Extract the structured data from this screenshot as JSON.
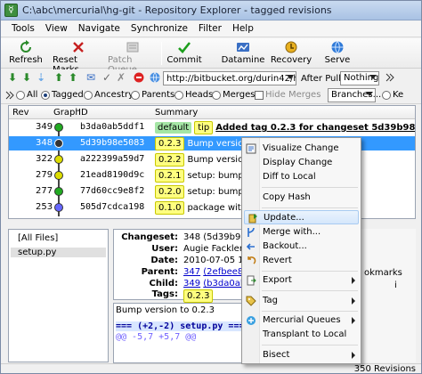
{
  "window": {
    "title": "C:\\abc\\mercurial\\hg-git - Repository Explorer - tagged revisions"
  },
  "menu": [
    "Tools",
    "View",
    "Navigate",
    "Synchronize",
    "Filter",
    "Help"
  ],
  "toolbar": {
    "refresh": "Refresh",
    "reset_marks": "Reset Marks",
    "patch_queue": "Patch Queue",
    "commit": "Commit",
    "datamine": "Datamine",
    "recovery": "Recovery",
    "serve": "Serve"
  },
  "nav": {
    "url": "http://bitbucket.org/durin42/h",
    "after_pull_label": "After Pull:",
    "after_pull_value": "Nothing"
  },
  "filter": {
    "all": "All",
    "tagged": "Tagged",
    "ancestry": "Ancestry",
    "parents": "Parents",
    "heads": "Heads",
    "merges": "Merges",
    "hide_merges": "Hide Merges",
    "branches": "Branches...",
    "keyword_fragment": "Ke"
  },
  "table": {
    "headers": {
      "rev": "Rev",
      "graph": "Graph",
      "id": "ID",
      "summary": "Summary"
    },
    "rows": [
      {
        "rev": "349",
        "id": "b3da0ab5ddf1",
        "branch": "default",
        "tag": "tip",
        "summary": "Added tag 0.2.3 for changeset 5d39b98e5083",
        "node_color": "#22aa22",
        "selected": false,
        "bold": true
      },
      {
        "rev": "348",
        "id": "5d39b98e5083",
        "branch": "",
        "tag": "0.2.3",
        "summary": "Bump version to",
        "node_color": "#333333",
        "selected": true,
        "bold": false
      },
      {
        "rev": "322",
        "id": "a222399a59d7",
        "branch": "",
        "tag": "0.2.2",
        "summary": "Bump version to",
        "node_color": "#dddd00",
        "selected": false,
        "bold": false
      },
      {
        "rev": "279",
        "id": "21ead8190d9c",
        "branch": "",
        "tag": "0.2.1",
        "summary": "setup: bump to",
        "node_color": "#dddd00",
        "selected": false,
        "bold": false
      },
      {
        "rev": "277",
        "id": "77d60cc9e8f2",
        "branch": "",
        "tag": "0.2.0",
        "summary": "setup: bump to",
        "node_color": "#22aa22",
        "selected": false,
        "bold": false
      },
      {
        "rev": "253",
        "id": "505d7cdca198",
        "branch": "",
        "tag": "0.1.0",
        "summary": "package with dist",
        "node_color": "#6666ff",
        "selected": false,
        "bold": false
      }
    ]
  },
  "files": {
    "all": "[All Files]",
    "item": "setup.py"
  },
  "details": {
    "changeset_label": "Changeset:",
    "changeset_value": "348 (5d39b98e50",
    "user_label": "User:",
    "user_value": "Augie Fackler <durin",
    "date_label": "Date:",
    "date_value": "2010-07-05 10:55:",
    "parent_label": "Parent:",
    "parent_rev": "347",
    "parent_value": "(2efbee89d3f7",
    "child_label": "Child:",
    "child_rev": "349",
    "child_value": "(b3da0ab5ddf1",
    "tags_label": "Tags:",
    "tags_value": "0.2.3"
  },
  "diff": {
    "message": "Bump version to 0.2.3",
    "file": "=== (+2,-2) setup.py ===",
    "hunk": "@@ -5,7 +5,7 @@"
  },
  "right_fragments": {
    "bookmarks": "okmarks",
    "patch_note": "i"
  },
  "status": {
    "revisions": "350 Revisions"
  },
  "context_menu": {
    "items": [
      {
        "label": "Visualize Change",
        "submenu": false
      },
      {
        "label": "Display Change",
        "submenu": false
      },
      {
        "label": "Diff to Local",
        "submenu": false
      },
      {
        "label": "Copy Hash",
        "submenu": false
      },
      {
        "label": "Update...",
        "submenu": false
      },
      {
        "label": "Merge with...",
        "submenu": false
      },
      {
        "label": "Backout...",
        "submenu": false
      },
      {
        "label": "Revert",
        "submenu": false
      },
      {
        "label": "Export",
        "submenu": true
      },
      {
        "label": "Tag",
        "submenu": true
      },
      {
        "label": "Mercurial Queues",
        "submenu": true
      },
      {
        "label": "Transplant to Local",
        "submenu": false
      },
      {
        "label": "Bisect",
        "submenu": true
      }
    ]
  },
  "colors": {
    "selection": "#3399ff",
    "menu_highlight": "#d5e7fb",
    "branch_chip": "#a5e6a5",
    "tag_chip": "#ffff80"
  }
}
